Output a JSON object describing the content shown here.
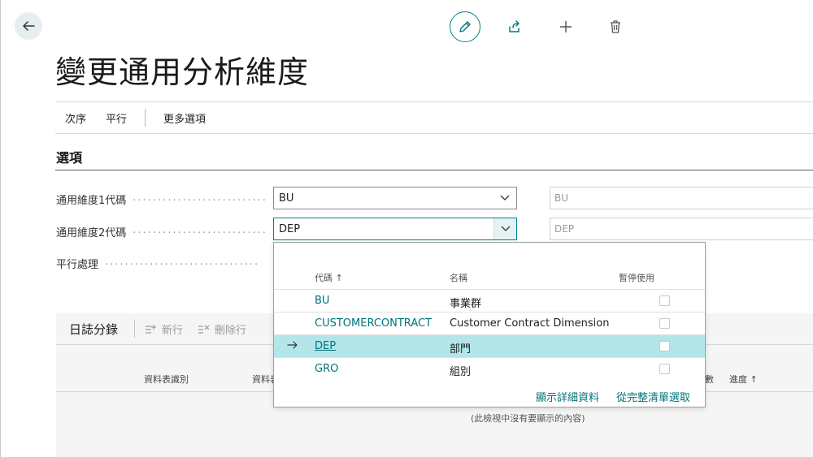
{
  "page": {
    "title": "變更通用分析維度"
  },
  "toolbar": {
    "icons": [
      "back-arrow-icon",
      "edit-icon",
      "share-icon",
      "add-icon",
      "delete-icon"
    ]
  },
  "actions": {
    "order": "次序",
    "parallel": "平行",
    "more_options": "更多選項"
  },
  "options": {
    "section_title": "選項",
    "dim1_label": "通用維度1代碼",
    "dim1_value": "BU",
    "dim1_readonly": "BU",
    "dim2_label": "通用維度2代碼",
    "dim2_value": "DEP",
    "dim2_readonly": "DEP",
    "parallel_label": "平行處理"
  },
  "journal": {
    "title": "日誌分錄",
    "new_line": "新行",
    "delete_line": "刪除行",
    "columns": {
      "table_id": "資料表識別",
      "table_name_partial": "資料表",
      "count_partial": "數",
      "progress": "進度 ↑"
    },
    "empty_message": "(此檢視中沒有要顯示的內容)"
  },
  "dropdown": {
    "headers": {
      "code": "代碼 ↑",
      "name": "名稱",
      "blocked": "暫停使用"
    },
    "rows": [
      {
        "code": "BU",
        "name": "事業群",
        "blocked": false
      },
      {
        "code": "CUSTOMERCONTRACT",
        "name": "Customer Contract Dimension",
        "blocked": false
      },
      {
        "code": "DEP",
        "name": "部門",
        "blocked": false
      },
      {
        "code": "GRO",
        "name": "組別",
        "blocked": false
      }
    ],
    "selected_row": 2,
    "show_details": "顯示詳細資料",
    "select_from_full_list": "從完整清單選取"
  },
  "colors": {
    "accent": "#008489",
    "link": "#00737a",
    "selected_row": "#b3e6e9"
  }
}
